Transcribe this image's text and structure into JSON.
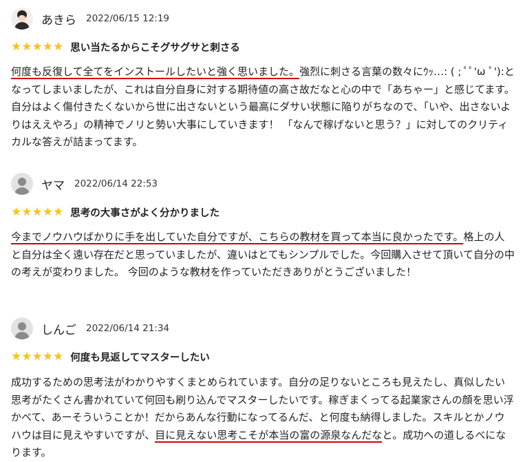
{
  "reviews": [
    {
      "user": "あきら",
      "date": "2022/06/15 12:19",
      "avatar": "user-photo-avatar",
      "stars": "★★★★★",
      "title": "思い当たるからこそグサグサと刺さる",
      "highlight": "何度も反復して全てをインストールしたいと強く思いました。",
      "text": "強烈に刺さる言葉の数々にｳｯ…: ( ; ﾟﾟ'ω ﾟ'):となってしまいましたが、これは自分自身に対する期待値の高さ故だなと心の中で「あちゃー」と感じてます。 自分はよく傷付きたくないから世に出さないという最高にダサい状態に陥りがちなので、「いや、出さないよりはええやろ」の精神でノリと勢い大事にしていきます！ 「なんで稼げないと思う？」に対してのクリティカルな答えが詰まってます。"
    },
    {
      "user": "ヤマ",
      "date": "2022/06/14 22:53",
      "avatar": "default-user-avatar",
      "stars": "★★★★★",
      "title": "思考の大事さがよく分かりました",
      "highlight": "今までノウハウばかりに手を出していた自分ですが、こちらの教材を買って本当に良かったです。",
      "text": "格上の人と自分は全く遠い存在だと思っていましたが、違いはとてもシンプルでした。今回購入させて頂いて自分の中の考えが変わりました。 今回のような教材を作っていただきありがとうございました！"
    },
    {
      "user": "しんご",
      "date": "2022/06/14 21:34",
      "avatar": "default-user-avatar",
      "stars": "★★★★★",
      "title": "何度も見返してマスターしたい",
      "text": "成功するための思考法がわかりやすくまとめられています。自分の足りないところも見えたし、真似したい思考がたくさん書かれていて何回も刷り込んでマスターしたいです。稼ぎまくってる起業家さんの顔を思い浮かべて、あーそういうことか！だからあんな行動になってるんだ、と何度も納得しました。スキルとかノウハウは目に見えやすいですが、",
      "highlight": "目に見えない思考こそが本当の富の源泉なんだな",
      "text_after": "と。成功への道しるべになります。"
    }
  ],
  "colors": {
    "star": "#f5c518",
    "highlight_underline": "#d40000"
  }
}
